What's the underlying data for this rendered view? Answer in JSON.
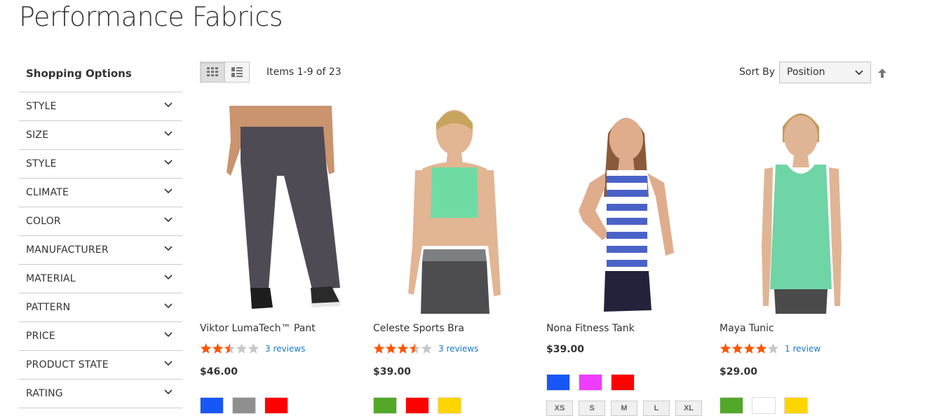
{
  "page": {
    "title": "Performance Fabrics"
  },
  "sidebar": {
    "title": "Shopping Options",
    "filters": [
      "STYLE",
      "SIZE",
      "STYLE",
      "CLIMATE",
      "COLOR",
      "MANUFACTURER",
      "MATERIAL",
      "PATTERN",
      "PRICE",
      "PRODUCT STATE",
      "RATING"
    ]
  },
  "toolbar": {
    "amount": "Items 1-9 of 23",
    "sort_label": "Sort By",
    "sort_value": "Position",
    "modes": [
      "grid-icon",
      "list-icon"
    ]
  },
  "products": [
    {
      "name": "Viktor LumaTech™ Pant",
      "rating": 2.5,
      "reviews": "3 reviews",
      "price": "$46.00",
      "swatches": [
        "#1857f7",
        "#8f8f8f",
        "#ff0000"
      ],
      "sizes": []
    },
    {
      "name": "Celeste Sports Bra",
      "rating": 3.5,
      "reviews": "3 reviews",
      "price": "$39.00",
      "swatches": [
        "#53a828",
        "#ff0000",
        "#ffd500"
      ],
      "sizes": []
    },
    {
      "name": "Nona Fitness Tank",
      "rating": 0,
      "reviews": "",
      "price": "$39.00",
      "swatches": [
        "#1857f7",
        "#ef3dff",
        "#ff0000"
      ],
      "sizes": [
        "XS",
        "S",
        "M",
        "L",
        "XL"
      ]
    },
    {
      "name": "Maya Tunic",
      "rating": 4,
      "reviews": "1 review",
      "price": "$29.00",
      "swatches": [
        "#53a828",
        "#ffffff",
        "#ffd500"
      ],
      "sizes": []
    }
  ],
  "colors": {
    "star_on": "#ff5501",
    "star_off": "#c7c7c7",
    "link": "#1979c3"
  }
}
